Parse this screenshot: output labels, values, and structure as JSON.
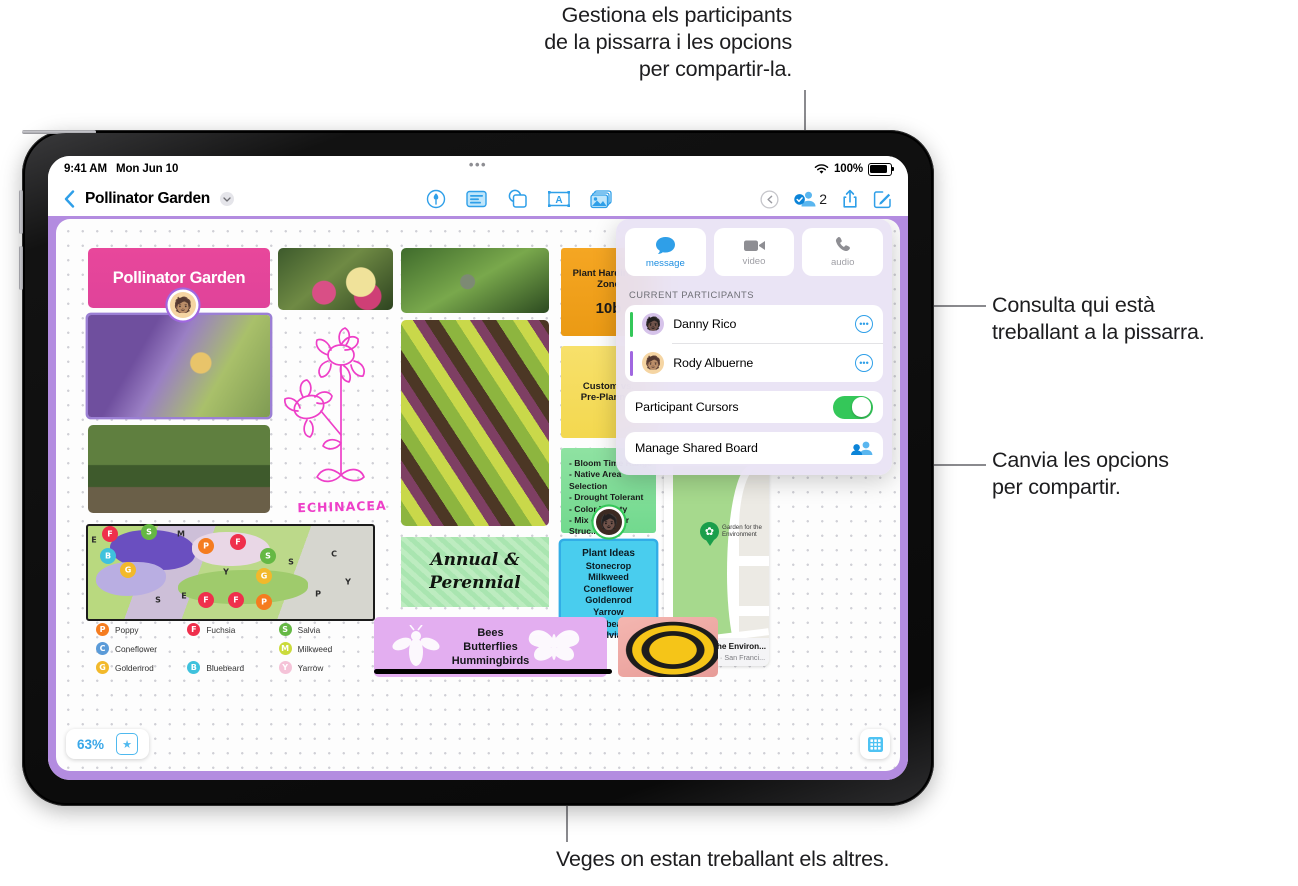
{
  "callouts": {
    "top": "Gestiona els participants\nde la pissarra i les opcions\nper compartir-la.",
    "top_l1": "Gestiona els participants",
    "top_l2": "de la pissarra i les opcions",
    "top_l3": "per compartir-la.",
    "right_top_l1": "Consulta qui està",
    "right_top_l2": "treballant a la pissarra.",
    "right_bottom_l1": "Canvia les opcions",
    "right_bottom_l2": "per compartir.",
    "bottom": "Veges on estan treballant els altres."
  },
  "status_bar": {
    "time": "9:41 AM",
    "date": "Mon Jun 10",
    "battery_percent": "100%",
    "wifi_icon": "wifi-icon",
    "battery_icon": "battery-icon",
    "dots": "•••"
  },
  "toolbar": {
    "back_icon": "chevron-left-icon",
    "title": "Pollinator Garden",
    "title_chevron_icon": "chevron-down-icon",
    "tools": [
      {
        "name": "pen-tool",
        "icon": "pen-marker-icon"
      },
      {
        "name": "sticky-note-tool",
        "icon": "sticky-note-icon"
      },
      {
        "name": "shapes-tool",
        "icon": "shapes-icon"
      },
      {
        "name": "text-box-tool",
        "icon": "text-box-icon"
      },
      {
        "name": "media-tool",
        "icon": "photos-icon"
      }
    ],
    "undo_icon": "undo-icon",
    "collaborate_icon": "collaborate-person-icon",
    "collaborator_count": "2",
    "share_icon": "share-icon",
    "compose_icon": "compose-icon"
  },
  "popover": {
    "actions": [
      {
        "label": "message",
        "icon": "message-bubble-icon",
        "state": "on"
      },
      {
        "label": "video",
        "icon": "video-camera-icon",
        "state": "off"
      },
      {
        "label": "audio",
        "icon": "phone-handset-icon",
        "state": "off"
      }
    ],
    "section_title": "CURRENT PARTICIPANTS",
    "participants": [
      {
        "name": "Danny Rico",
        "cursor_color": "#34c759",
        "avatar": "🧑🏿",
        "more_icon": "more-circle-icon"
      },
      {
        "name": "Rody Albuerne",
        "cursor_color": "#a067e0",
        "avatar": "🧑🏽",
        "more_icon": "more-circle-icon"
      }
    ],
    "cursors_label": "Participant Cursors",
    "cursors_on": "true",
    "manage_label": "Manage Shared Board",
    "manage_icon": "manage-people-icon"
  },
  "canvas": {
    "border_color": "#b38ce0",
    "zoom_level": "63%",
    "star_icon": "star-icon",
    "grid_icon": "grid-icon",
    "title_card": "Pollinator Garden",
    "sketch_label": "ECHINACEA",
    "handwriting_l1": "Annual &",
    "handwriting_l2": "Perennial",
    "notes": {
      "hardiness_title_l1": "Plant Hardiness",
      "hardiness_title_l2": "Zone",
      "hardiness_value": "10b",
      "custom_l1": "Custom vs.",
      "custom_l2": "Pre-Planned",
      "bullets": [
        "- Bloom Time Range",
        "- Native Area",
        "   Selection",
        "- Drought Tolerant",
        "- Color Variety",
        "- Mix of Flower",
        "   Struc..."
      ],
      "plant_ideas_title": "Plant Ideas",
      "plant_ideas": [
        "Stonecrop",
        "Milkweed",
        "Coneflower",
        "Goldenrod",
        "Yarrow",
        "Bluebeard",
        "Salvia"
      ]
    },
    "banner": [
      "Bees",
      "Butterflies",
      "Hummingbirds"
    ],
    "map": {
      "pin_label_l1": "Garden for the",
      "pin_label_l2": "Environment",
      "title": "Garden for the Environ...",
      "subtitle": " Maps · Garden · San Franci..."
    },
    "legend": [
      {
        "letter": "P",
        "label": "Poppy",
        "color": "#f57c1f"
      },
      {
        "letter": "F",
        "label": "Fuchsia",
        "color": "#ef2f4c"
      },
      {
        "letter": "S",
        "label": "Salvia",
        "color": "#65b844"
      },
      {
        "letter": "C",
        "label": "Coneflower",
        "color": "#5b9bd8"
      },
      {
        "letter": "M",
        "label": "Milkweed",
        "color": "#cbdb3c"
      },
      {
        "letter": "G",
        "label": "Goldenrod",
        "color": "#f2b92b"
      },
      {
        "letter": "B",
        "label": "Bluebeard",
        "color": "#3fc2dd"
      },
      {
        "letter": "Y",
        "label": "Yarrow",
        "color": "#f5c3d8"
      }
    ]
  },
  "colors": {
    "accent_blue": "#2f9fe8",
    "purple_border": "#b38ce0",
    "green_toggle": "#34c759",
    "pink_title": "#e0439a"
  }
}
